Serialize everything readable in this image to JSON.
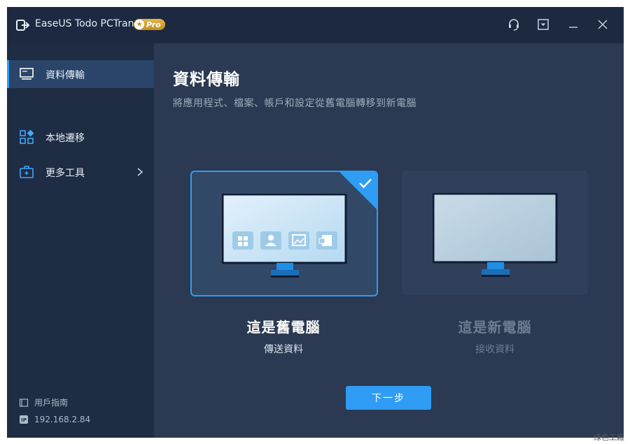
{
  "app": {
    "title": "EaseUS Todo PCTrans",
    "badge": "Pro"
  },
  "sidebar": {
    "items": [
      {
        "label": "資料傳輸",
        "icon": "monitor-icon",
        "active": true
      },
      {
        "label": "本地遷移",
        "icon": "apps-grid-icon",
        "active": false
      },
      {
        "label": "更多工具",
        "icon": "toolbox-icon",
        "active": false
      }
    ],
    "footer": {
      "guide_label": "用戶指南",
      "ip": "192.168.2.84"
    }
  },
  "main": {
    "title": "資料傳輸",
    "subtitle": "將應用程式、檔案、帳戶和設定從舊電腦轉移到新電腦",
    "options": [
      {
        "title": "這是舊電腦",
        "subtitle": "傳送資料",
        "selected": true
      },
      {
        "title": "這是新電腦",
        "subtitle": "接收資料",
        "selected": false
      }
    ],
    "next_button": "下一步"
  },
  "colors": {
    "accent": "#2f9df4",
    "window_bg": "#2b3a52",
    "sidebar_bg": "#1e2c44",
    "titlebar_bg": "#1c2940"
  },
  "watermark": "綠色工廠"
}
